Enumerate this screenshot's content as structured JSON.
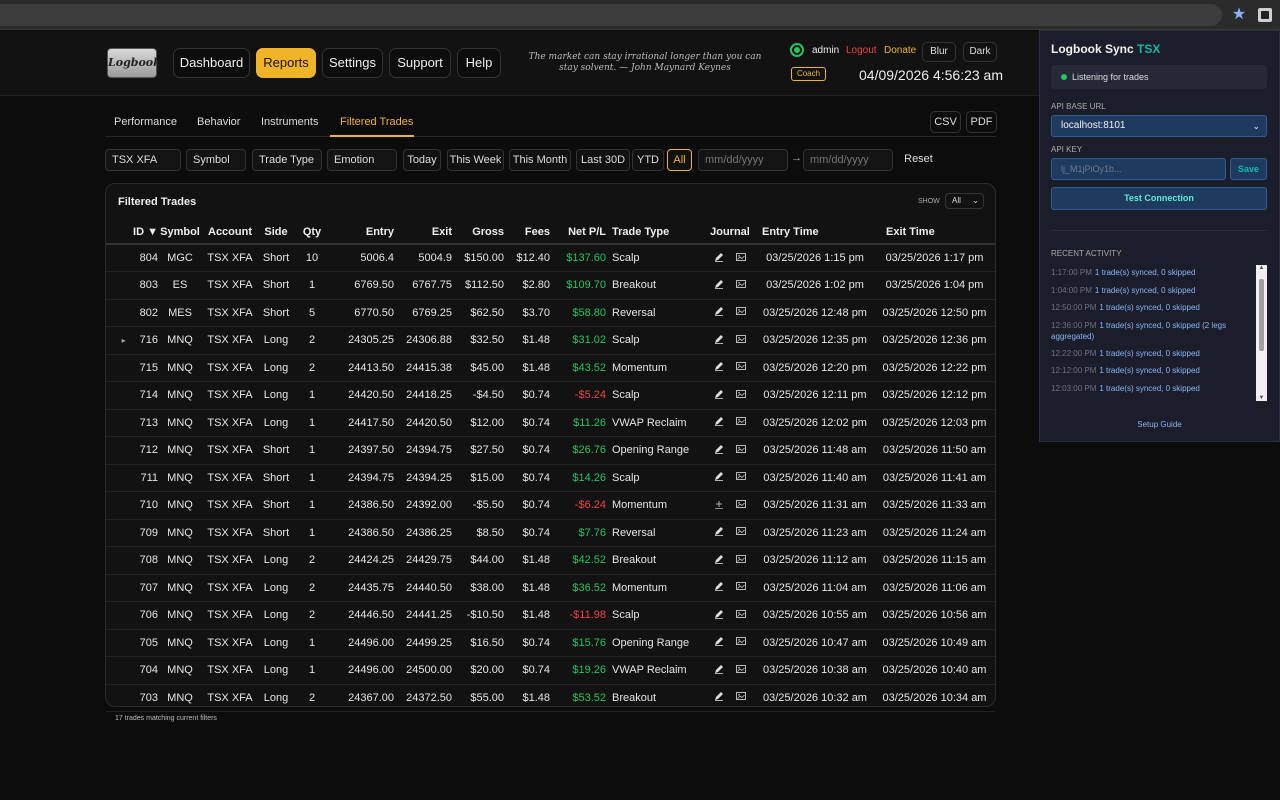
{
  "header": {
    "logo_text": "Logbook",
    "nav": [
      "Dashboard",
      "Reports",
      "Settings",
      "Support",
      "Help"
    ],
    "active_nav": "Reports",
    "quote": "The market can stay irrational longer than you can stay solvent. — John Maynard Keynes",
    "user": "admin",
    "logout": "Logout",
    "donate": "Donate",
    "blur": "Blur",
    "dark": "Dark",
    "coach": "Coach",
    "clock": "04/09/2026 4:56:23 am"
  },
  "tabs": [
    "Performance",
    "Behavior",
    "Instruments",
    "Filtered Trades"
  ],
  "active_tab": "Filtered Trades",
  "export": {
    "csv": "CSV",
    "pdf": "PDF"
  },
  "filters": {
    "account": "TSX XFA",
    "symbol": "Symbol",
    "trade_type": "Trade Type",
    "emotion": "Emotion",
    "ranges": [
      "Today",
      "This Week",
      "This Month",
      "Last 30D",
      "YTD",
      "All"
    ],
    "active_range": "All",
    "date_from": "mm/dd/yyyy",
    "date_to": "mm/dd/yyyy",
    "arrow": "→",
    "reset": "Reset"
  },
  "panel": {
    "title": "Filtered Trades",
    "show_label": "SHOW",
    "show_value": "All",
    "footer": "17 trades matching current filters"
  },
  "columns": [
    "ID ▼",
    "Symbol",
    "Account",
    "Side",
    "Qty",
    "Entry",
    "Exit",
    "Gross",
    "Fees",
    "Net P/L",
    "Trade Type",
    "Journal",
    "Entry Time",
    "Exit Time"
  ],
  "rows": [
    {
      "id": "804",
      "symbol": "MGC",
      "account": "TSX XFA",
      "side": "Short",
      "qty": "10",
      "entry": "5006.4",
      "exit": "5004.9",
      "gross": "$150.00",
      "fees": "$12.40",
      "net": "$137.60",
      "pl": "pos",
      "type": "Scalp",
      "entry_time": "03/25/2026 1:15 pm",
      "exit_time": "03/25/2026 1:17 pm",
      "caret": "",
      "journal": "edit"
    },
    {
      "id": "803",
      "symbol": "ES",
      "account": "TSX XFA",
      "side": "Short",
      "qty": "1",
      "entry": "6769.50",
      "exit": "6767.75",
      "gross": "$112.50",
      "fees": "$2.80",
      "net": "$109.70",
      "pl": "pos",
      "type": "Breakout",
      "entry_time": "03/25/2026 1:02 pm",
      "exit_time": "03/25/2026 1:04 pm",
      "caret": "",
      "journal": "edit"
    },
    {
      "id": "802",
      "symbol": "MES",
      "account": "TSX XFA",
      "side": "Short",
      "qty": "5",
      "entry": "6770.50",
      "exit": "6769.25",
      "gross": "$62.50",
      "fees": "$3.70",
      "net": "$58.80",
      "pl": "pos",
      "type": "Reversal",
      "entry_time": "03/25/2026 12:48 pm",
      "exit_time": "03/25/2026 12:50 pm",
      "caret": "",
      "journal": "edit"
    },
    {
      "id": "716",
      "symbol": "MNQ",
      "account": "TSX XFA",
      "side": "Long",
      "qty": "2",
      "entry": "24305.25",
      "exit": "24306.88",
      "gross": "$32.50",
      "fees": "$1.48",
      "net": "$31.02",
      "pl": "pos",
      "type": "Scalp",
      "entry_time": "03/25/2026 12:35 pm",
      "exit_time": "03/25/2026 12:36 pm",
      "caret": "▸",
      "journal": "edit"
    },
    {
      "id": "715",
      "symbol": "MNQ",
      "account": "TSX XFA",
      "side": "Long",
      "qty": "2",
      "entry": "24413.50",
      "exit": "24415.38",
      "gross": "$45.00",
      "fees": "$1.48",
      "net": "$43.52",
      "pl": "pos",
      "type": "Momentum",
      "entry_time": "03/25/2026 12:20 pm",
      "exit_time": "03/25/2026 12:22 pm",
      "caret": "",
      "journal": "edit"
    },
    {
      "id": "714",
      "symbol": "MNQ",
      "account": "TSX XFA",
      "side": "Long",
      "qty": "1",
      "entry": "24420.50",
      "exit": "24418.25",
      "gross": "-$4.50",
      "fees": "$0.74",
      "net": "-$5.24",
      "pl": "neg",
      "type": "Scalp",
      "entry_time": "03/25/2026 12:11 pm",
      "exit_time": "03/25/2026 12:12 pm",
      "caret": "",
      "journal": "edit"
    },
    {
      "id": "713",
      "symbol": "MNQ",
      "account": "TSX XFA",
      "side": "Long",
      "qty": "1",
      "entry": "24417.50",
      "exit": "24420.50",
      "gross": "$12.00",
      "fees": "$0.74",
      "net": "$11.26",
      "pl": "pos",
      "type": "VWAP Reclaim",
      "entry_time": "03/25/2026 12:02 pm",
      "exit_time": "03/25/2026 12:03 pm",
      "caret": "",
      "journal": "edit"
    },
    {
      "id": "712",
      "symbol": "MNQ",
      "account": "TSX XFA",
      "side": "Short",
      "qty": "1",
      "entry": "24397.50",
      "exit": "24394.75",
      "gross": "$27.50",
      "fees": "$0.74",
      "net": "$26.76",
      "pl": "pos",
      "type": "Opening Range",
      "entry_time": "03/25/2026 11:48 am",
      "exit_time": "03/25/2026 11:50 am",
      "caret": "",
      "journal": "edit"
    },
    {
      "id": "711",
      "symbol": "MNQ",
      "account": "TSX XFA",
      "side": "Short",
      "qty": "1",
      "entry": "24394.75",
      "exit": "24394.25",
      "gross": "$15.00",
      "fees": "$0.74",
      "net": "$14.26",
      "pl": "pos",
      "type": "Scalp",
      "entry_time": "03/25/2026 11:40 am",
      "exit_time": "03/25/2026 11:41 am",
      "caret": "",
      "journal": "edit"
    },
    {
      "id": "710",
      "symbol": "MNQ",
      "account": "TSX XFA",
      "side": "Short",
      "qty": "1",
      "entry": "24386.50",
      "exit": "24392.00",
      "gross": "-$5.50",
      "fees": "$0.74",
      "net": "-$6.24",
      "pl": "neg",
      "type": "Momentum",
      "entry_time": "03/25/2026 11:31 am",
      "exit_time": "03/25/2026 11:33 am",
      "caret": "",
      "journal": "add"
    },
    {
      "id": "709",
      "symbol": "MNQ",
      "account": "TSX XFA",
      "side": "Short",
      "qty": "1",
      "entry": "24386.50",
      "exit": "24386.25",
      "gross": "$8.50",
      "fees": "$0.74",
      "net": "$7.76",
      "pl": "pos",
      "type": "Reversal",
      "entry_time": "03/25/2026 11:23 am",
      "exit_time": "03/25/2026 11:24 am",
      "caret": "",
      "journal": "edit"
    },
    {
      "id": "708",
      "symbol": "MNQ",
      "account": "TSX XFA",
      "side": "Long",
      "qty": "2",
      "entry": "24424.25",
      "exit": "24429.75",
      "gross": "$44.00",
      "fees": "$1.48",
      "net": "$42.52",
      "pl": "pos",
      "type": "Breakout",
      "entry_time": "03/25/2026 11:12 am",
      "exit_time": "03/25/2026 11:15 am",
      "caret": "",
      "journal": "edit"
    },
    {
      "id": "707",
      "symbol": "MNQ",
      "account": "TSX XFA",
      "side": "Long",
      "qty": "2",
      "entry": "24435.75",
      "exit": "24440.50",
      "gross": "$38.00",
      "fees": "$1.48",
      "net": "$36.52",
      "pl": "pos",
      "type": "Momentum",
      "entry_time": "03/25/2026 11:04 am",
      "exit_time": "03/25/2026 11:06 am",
      "caret": "",
      "journal": "edit"
    },
    {
      "id": "706",
      "symbol": "MNQ",
      "account": "TSX XFA",
      "side": "Long",
      "qty": "2",
      "entry": "24446.50",
      "exit": "24441.25",
      "gross": "-$10.50",
      "fees": "$1.48",
      "net": "-$11.98",
      "pl": "neg",
      "type": "Scalp",
      "entry_time": "03/25/2026 10:55 am",
      "exit_time": "03/25/2026 10:56 am",
      "caret": "",
      "journal": "edit"
    },
    {
      "id": "705",
      "symbol": "MNQ",
      "account": "TSX XFA",
      "side": "Long",
      "qty": "1",
      "entry": "24496.00",
      "exit": "24499.25",
      "gross": "$16.50",
      "fees": "$0.74",
      "net": "$15.76",
      "pl": "pos",
      "type": "Opening Range",
      "entry_time": "03/25/2026 10:47 am",
      "exit_time": "03/25/2026 10:49 am",
      "caret": "",
      "journal": "edit"
    },
    {
      "id": "704",
      "symbol": "MNQ",
      "account": "TSX XFA",
      "side": "Long",
      "qty": "1",
      "entry": "24496.00",
      "exit": "24500.00",
      "gross": "$20.00",
      "fees": "$0.74",
      "net": "$19.26",
      "pl": "pos",
      "type": "VWAP Reclaim",
      "entry_time": "03/25/2026 10:38 am",
      "exit_time": "03/25/2026 10:40 am",
      "caret": "",
      "journal": "edit"
    },
    {
      "id": "703",
      "symbol": "MNQ",
      "account": "TSX XFA",
      "side": "Long",
      "qty": "2",
      "entry": "24367.00",
      "exit": "24372.50",
      "gross": "$55.00",
      "fees": "$1.48",
      "net": "$53.52",
      "pl": "pos",
      "type": "Breakout",
      "entry_time": "03/25/2026 10:32 am",
      "exit_time": "03/25/2026 10:34 am",
      "caret": "",
      "journal": "edit"
    }
  ],
  "popup": {
    "title": "Logbook Sync",
    "title_highlight": "TSX",
    "status": "Listening for trades",
    "api_base_label": "API BASE URL",
    "api_base_value": "localhost:8101",
    "api_key_label": "API KEY",
    "api_key_value": "lj_M1jPiOy1b...",
    "save": "Save",
    "test": "Test Connection",
    "recent_label": "RECENT ACTIVITY",
    "activity": [
      {
        "time": "1:17:00 PM",
        "msg": "1 trade(s) synced, 0 skipped"
      },
      {
        "time": "1:04:00 PM",
        "msg": "1 trade(s) synced, 0 skipped"
      },
      {
        "time": "12:50:00 PM",
        "msg": "1 trade(s) synced, 0 skipped"
      },
      {
        "time": "12:36:00 PM",
        "msg": "1 trade(s) synced, 0 skipped (2 legs aggregated)"
      },
      {
        "time": "12:22:00 PM",
        "msg": "1 trade(s) synced, 0 skipped"
      },
      {
        "time": "12:12:00 PM",
        "msg": "1 trade(s) synced, 0 skipped"
      },
      {
        "time": "12:03:00 PM",
        "msg": "1 trade(s) synced, 0 skipped"
      }
    ],
    "guide": "Setup Guide"
  },
  "colors": {
    "accent": "#f0b429",
    "positive": "#22c55e",
    "negative": "#ef4444",
    "teal": "#14b8a6"
  }
}
